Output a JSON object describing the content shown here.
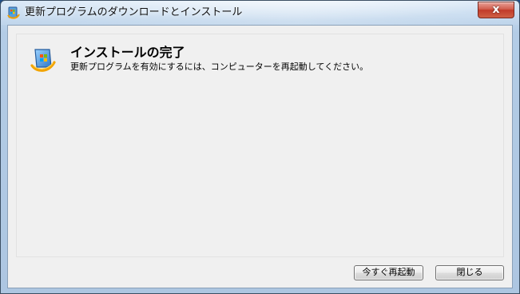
{
  "window": {
    "title": "更新プログラムのダウンロードとインストール",
    "close_glyph": "x",
    "icons": {
      "app": "windows-update-icon",
      "close": "close-icon",
      "content": "windows-update-icon"
    }
  },
  "content": {
    "heading": "インストールの完了",
    "message": "更新プログラムを有効にするには、コンピューターを再起動してください。"
  },
  "buttons": {
    "restart_now": "今すぐ再起動",
    "close": "閉じる"
  },
  "colors": {
    "window_bg": "#f0f0f0",
    "frame_blue": "#b3cce6",
    "close_red": "#c13b2a"
  }
}
